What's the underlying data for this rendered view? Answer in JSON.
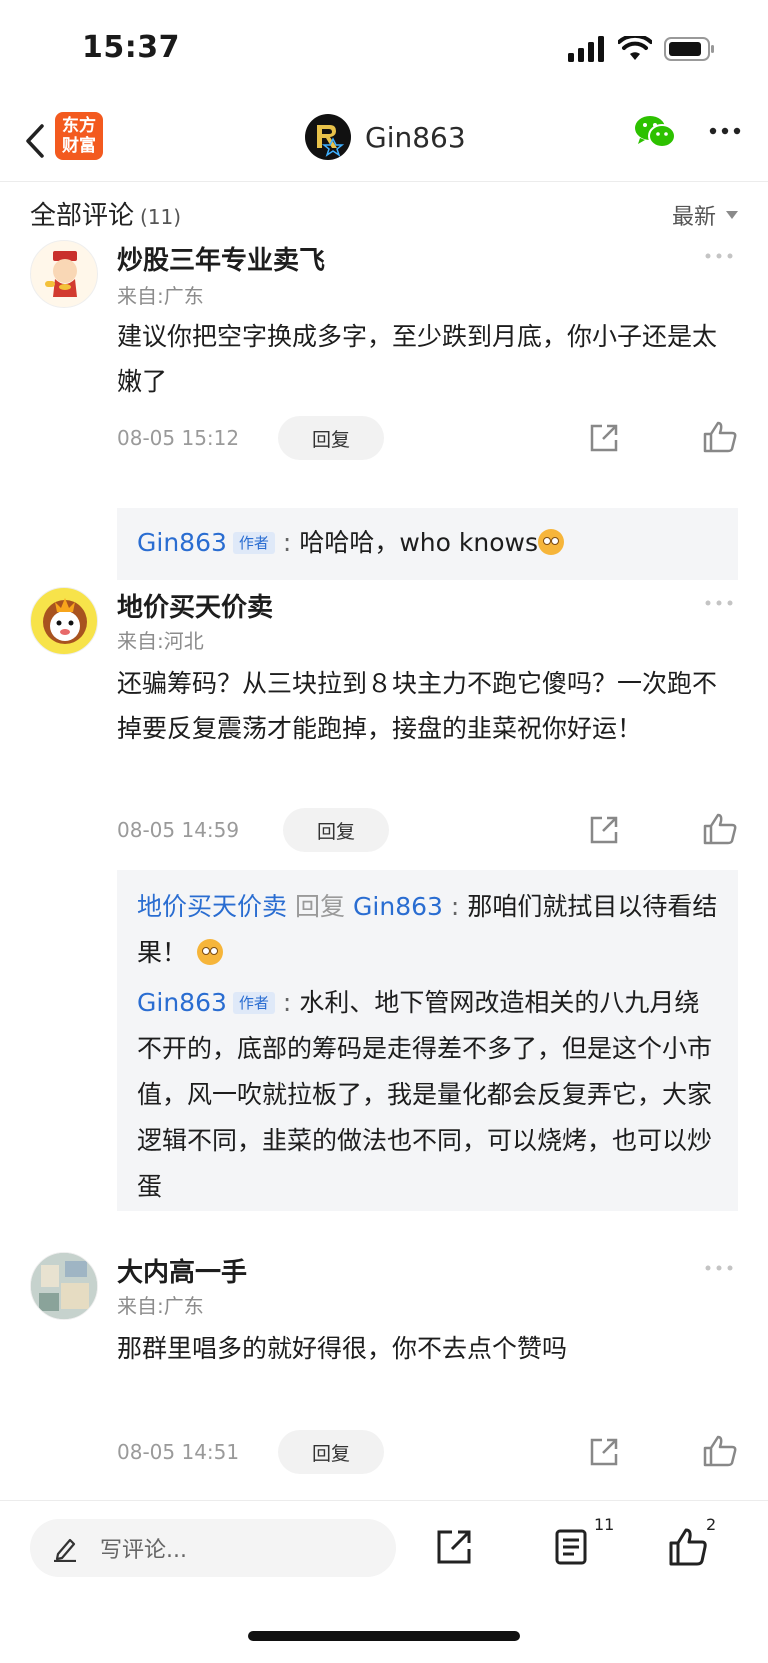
{
  "status": {
    "time": "15:37"
  },
  "nav": {
    "logo_line1": "东方",
    "logo_line2": "财富",
    "title": "Gin863"
  },
  "list": {
    "title": "全部评论",
    "count": "(11)",
    "sort_label": "最新"
  },
  "comments": [
    {
      "name": "炒股三年专业卖飞",
      "location": "来自:广东",
      "text": "建议你把空字换成多字，至少跌到月底，你小子还是太嫩了",
      "time": "08-05 15:12",
      "reply_label": "回复",
      "replies": [
        {
          "user": "Gin863",
          "tag": "作者",
          "text": "哈哈哈，who knows"
        }
      ]
    },
    {
      "name": "地价买天价卖",
      "location": "来自:河北",
      "text": "还骗筹码？从三块拉到８块主力不跑它傻吗？一次跑不掉要反复震荡才能跑掉，接盘的韭菜祝你好运！",
      "time": "08-05 14:59",
      "reply_label": "回复",
      "replies": [
        {
          "user": "地价买天价卖",
          "reply_word": "回复",
          "target": "Gin863",
          "text": "那咱们就拭目以待看结果！"
        },
        {
          "user": "Gin863",
          "tag": "作者",
          "text": "水利、地下管网改造相关的八九月绕不开的，底部的筹码是走得差不多了，但是这个小市值，风一吹就拉板了，我是量化都会反复弄它，大家逻辑不同，韭菜的做法也不同，可以烧烤，也可以炒蛋"
        }
      ]
    },
    {
      "name": "大内高一手",
      "location": "来自:广东",
      "text": "那群里唱多的就好得很，你不去点个赞吗",
      "time": "08-05 14:51",
      "reply_label": "回复"
    }
  ],
  "bottom_bar": {
    "input_placeholder": "写评论...",
    "comment_count": "11",
    "like_count": "2"
  },
  "colors": {
    "brand_orange": "#f35a1f",
    "link_blue": "#2a6dd1",
    "wechat_green": "#2dc100"
  }
}
